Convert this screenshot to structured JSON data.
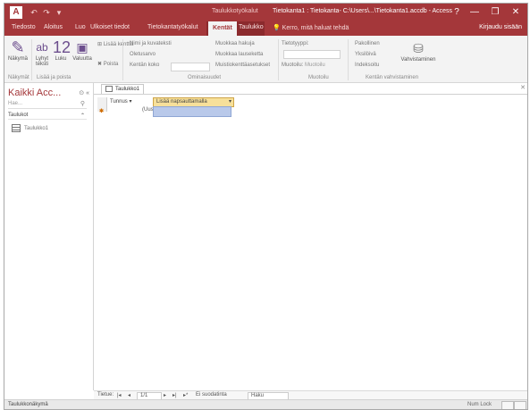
{
  "window": {
    "app_icon": "A",
    "context_tab_group": "Taulukkotyökalut",
    "title": "Tietokanta1 : Tietokanta- C:\\Users\\...\\Tietokanta1.accdb - Access",
    "help_glyph": "?",
    "min_glyph": "—",
    "max_glyph": "❐",
    "close_glyph": "✕"
  },
  "quick_access": [
    "↶",
    "↷",
    "▾"
  ],
  "tabs": [
    "Tiedosto",
    "Aloitus",
    "Luo",
    "Ulkoiset tiedot",
    "Tietokantatyökalut",
    "Kentät",
    "Taulukko"
  ],
  "active_tab_index": 5,
  "tell_me": "Kerro, mitä haluat tehdä",
  "sign_in": "Kirjaudu sisään",
  "ribbon": {
    "view_label": "Näkymä",
    "text_label": "Lyhyt teksti",
    "number_big": "12",
    "number_label": "Luku",
    "currency_label": "Valuutta",
    "more_fields": "Lisää kenttiä",
    "delete_label": "Poista",
    "name_caption": "Nimi ja kuvateksti",
    "default_value": "Oletusarvo",
    "field_size": "Kentän koko",
    "modify_lookups": "Muokkaa hakuja",
    "modify_expression": "Muokkaa lauseketta",
    "memo_settings": "Muistiokenttäasetukset",
    "data_type": "Tietotyyppi:",
    "format": "Muotoilu:",
    "format_value": "Muotoilu",
    "required": "Pakollinen",
    "unique": "Yksilöivä",
    "indexed": "Indeksoitu",
    "validation": "Vahvistaminen",
    "groups": {
      "views": "Näkymät",
      "add_delete": "Lisää ja poista",
      "properties": "Ominaisuudet",
      "formatting": "Muotoilu",
      "field_validation": "Kentän vahvistaminen"
    }
  },
  "nav": {
    "title": "Kaikki Acc...",
    "search_placeholder": "Hae...",
    "section": "Taulukot",
    "items": [
      "Taulukko1"
    ]
  },
  "document": {
    "tab_label": "Taulukko1",
    "columns": [
      "Tunnus",
      "Lisää napsauttamalla"
    ],
    "new_record_text": "(Uusi)"
  },
  "record_nav": {
    "label": "Tietue:",
    "first": "|◂",
    "prev": "◂",
    "position": "1/1",
    "next": "▸",
    "last": "▸|",
    "new": "▸*",
    "filter": "Ei suodatinta",
    "search": "Haku"
  },
  "status": {
    "text": "Taulukkonäkymä",
    "right": "Num Lock"
  }
}
